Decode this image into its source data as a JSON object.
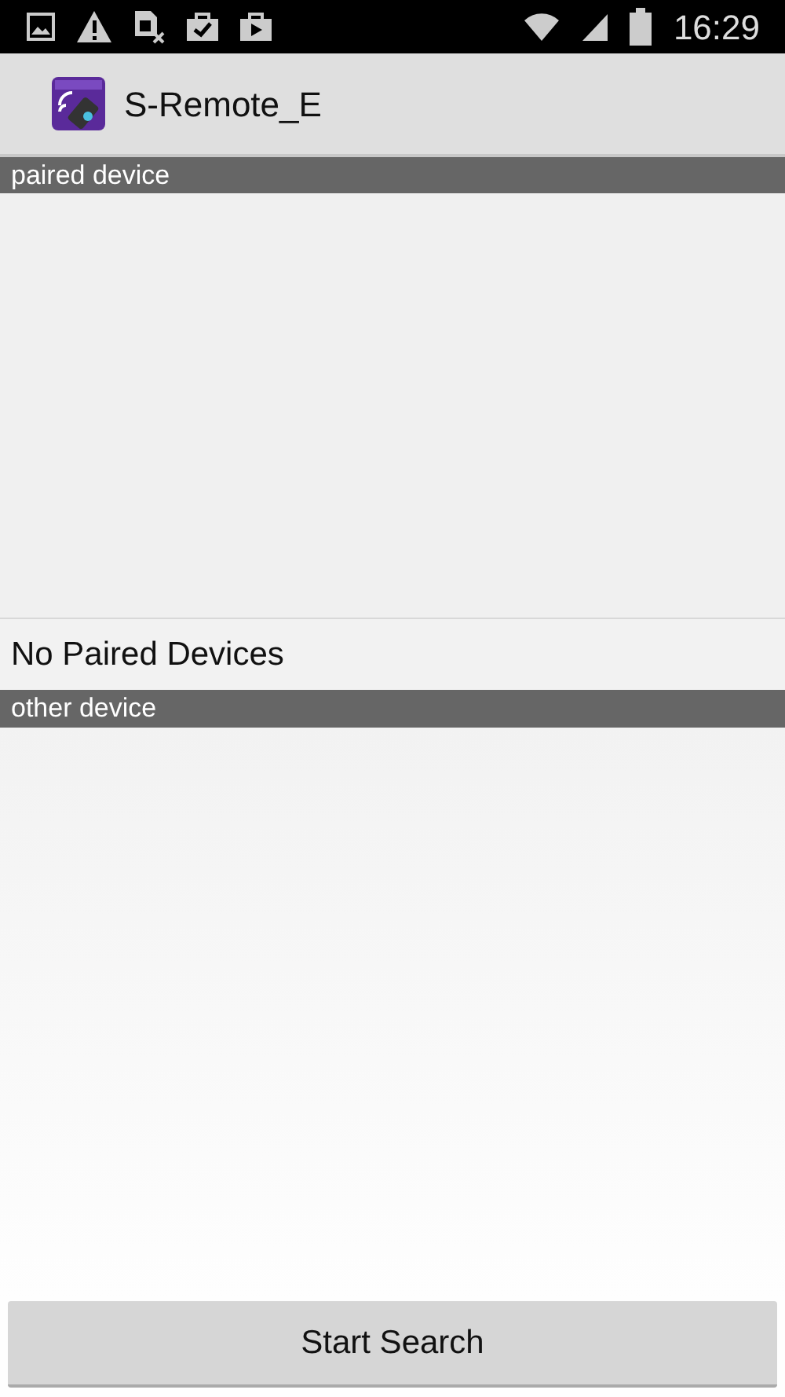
{
  "status_bar": {
    "time": "16:29"
  },
  "action_bar": {
    "title": "S-Remote_E"
  },
  "sections": [
    {
      "header": "paired device",
      "empty_text": "No Paired Devices"
    },
    {
      "header": "other device"
    }
  ],
  "button": {
    "label": "Start Search"
  }
}
